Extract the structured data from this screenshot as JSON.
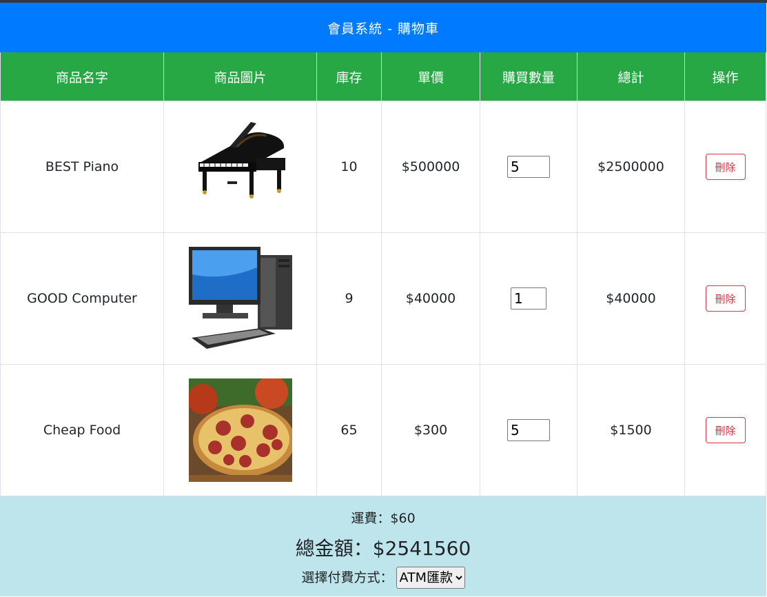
{
  "header": {
    "title": "會員系統 - 購物車"
  },
  "columns": [
    "商品名字",
    "商品圖片",
    "庫存",
    "單價",
    "購買數量",
    "總計",
    "操作"
  ],
  "items": [
    {
      "name": "BEST Piano",
      "image_icon": "piano-image",
      "stock": "10",
      "price": "$500000",
      "qty": "5",
      "total": "$2500000",
      "delete_label": "刪除"
    },
    {
      "name": "GOOD Computer",
      "image_icon": "computer-image",
      "stock": "9",
      "price": "$40000",
      "qty": "1",
      "total": "$40000",
      "delete_label": "刪除"
    },
    {
      "name": "Cheap Food",
      "image_icon": "pizza-image",
      "stock": "65",
      "price": "$300",
      "qty": "5",
      "total": "$1500",
      "delete_label": "刪除"
    }
  ],
  "summary": {
    "shipping": "運費：$60",
    "grand_total": "總金額：$2541560",
    "payment_label": "選擇付費方式：",
    "payment_selected": "ATM匯款"
  },
  "colors": {
    "title_bg": "#007bff",
    "header_bg": "#28a745",
    "footer_bg": "#bee5eb",
    "danger": "#dc3545"
  }
}
